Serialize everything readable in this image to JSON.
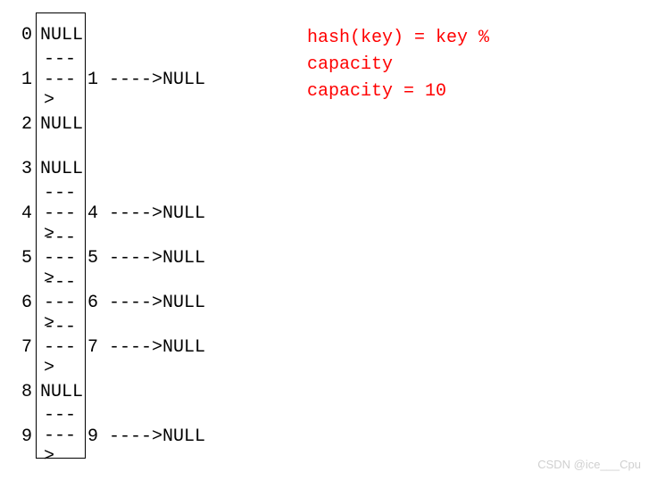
{
  "hash_table": {
    "capacity": 10,
    "buckets": [
      {
        "index": "0",
        "arrow": "",
        "cell": "NULL",
        "chain": ""
      },
      {
        "index": "1",
        "arrow": "------>",
        "cell": "",
        "chain": "1  ---->NULL"
      },
      {
        "index": "2",
        "arrow": "",
        "cell": "NULL",
        "chain": ""
      },
      {
        "index": "3",
        "arrow": "",
        "cell": "NULL",
        "chain": ""
      },
      {
        "index": "4",
        "arrow": "------>",
        "cell": "",
        "chain": "4  ---->NULL"
      },
      {
        "index": "5",
        "arrow": "------>",
        "cell": "",
        "chain": "5  ---->NULL"
      },
      {
        "index": "6",
        "arrow": "------>",
        "cell": "",
        "chain": "6  ---->NULL"
      },
      {
        "index": "7",
        "arrow": "------>",
        "cell": "",
        "chain": "7  ---->NULL"
      },
      {
        "index": "8",
        "arrow": "",
        "cell": "NULL",
        "chain": ""
      },
      {
        "index": "9",
        "arrow": "------>",
        "cell": "",
        "chain": "9  ---->NULL"
      }
    ]
  },
  "formula": {
    "line1": "hash(key) = key %",
    "line2": "capacity",
    "line3": "capacity = 10"
  },
  "watermark": "CSDN @ice___Cpu"
}
